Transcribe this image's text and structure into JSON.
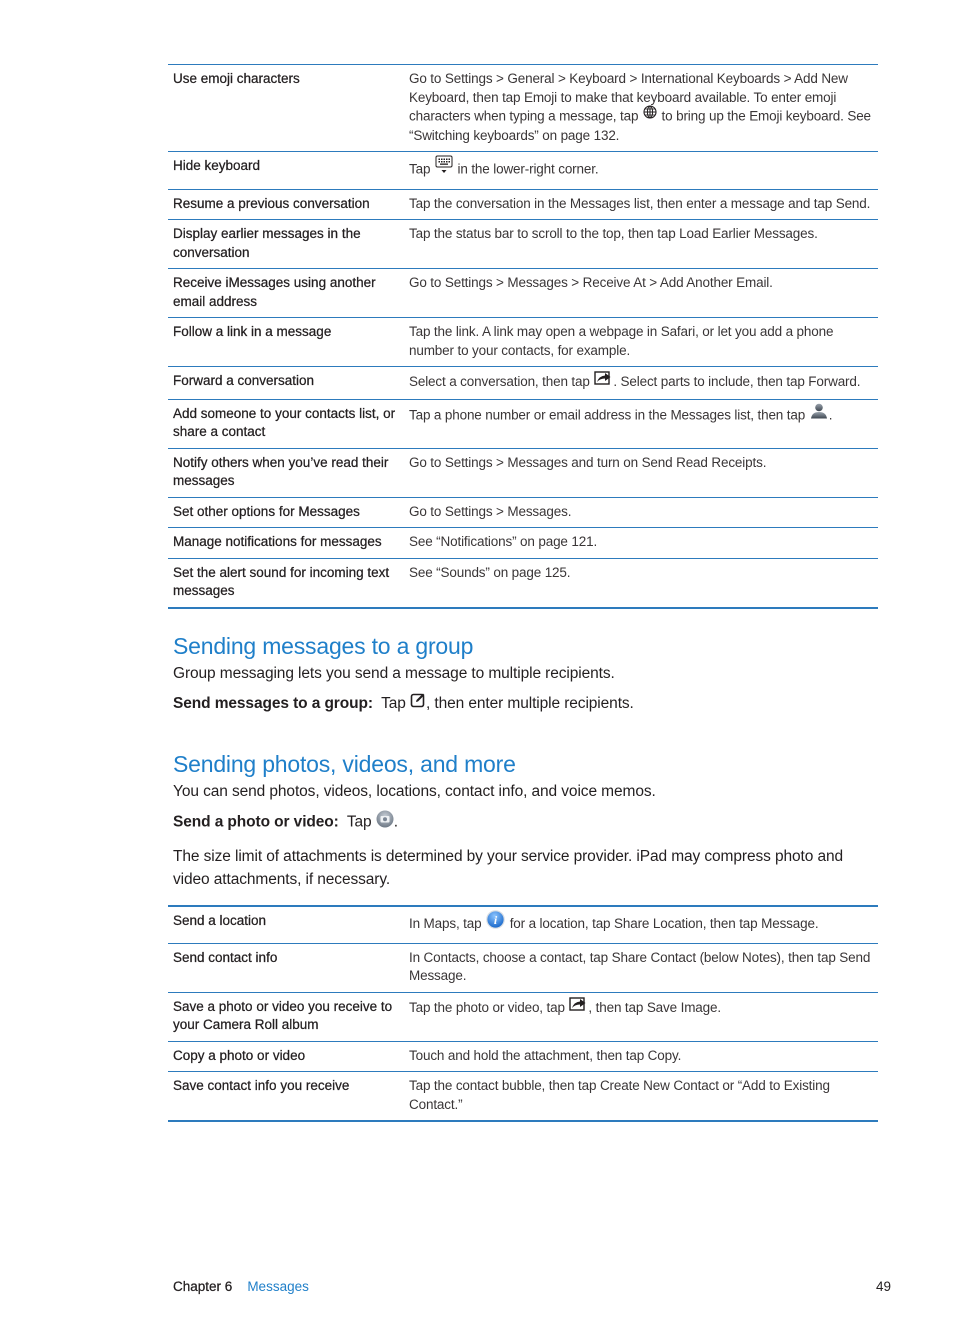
{
  "table1": {
    "rows": [
      {
        "task": "Use emoji characters",
        "how_parts": [
          "Go to Settings > General > Keyboard > International Keyboards > Add New Keyboard, then tap Emoji to make that keyboard available. To enter emoji characters when typing a message, tap ",
          " to bring up the Emoji keyboard. See “Switching keyboards” on page 132."
        ],
        "icon": "globe-icon"
      },
      {
        "task": "Hide keyboard",
        "how_parts": [
          "Tap ",
          " in the lower-right corner."
        ],
        "icon": "hide-keyboard-icon"
      },
      {
        "task": "Resume a previous conversation",
        "how_parts": [
          "Tap the conversation in the Messages list, then enter a message and tap Send."
        ]
      },
      {
        "task": "Display earlier messages in the conversation",
        "how_parts": [
          "Tap the status bar to scroll to the top, then tap Load Earlier Messages."
        ]
      },
      {
        "task": "Receive iMessages using another email address",
        "how_parts": [
          "Go to Settings > Messages > Receive At > Add Another Email."
        ]
      },
      {
        "task": "Follow a link in a message",
        "how_parts": [
          "Tap the link. A link may open a webpage in Safari, or let you add a phone number to your contacts, for example."
        ]
      },
      {
        "task": "Forward a conversation",
        "how_parts": [
          "Select a conversation, then tap ",
          ". Select parts to include, then tap Forward."
        ],
        "icon": "action-icon"
      },
      {
        "task": "Add someone to your contacts list, or share a contact",
        "how_parts": [
          "Tap a phone number or email address in the Messages list, then tap ",
          "."
        ],
        "icon": "contact-icon"
      },
      {
        "task": "Notify others when you’ve read their messages",
        "how_parts": [
          "Go to Settings > Messages and turn on Send Read Receipts."
        ]
      },
      {
        "task": "Set other options for Messages",
        "how_parts": [
          "Go to Settings > Messages."
        ]
      },
      {
        "task": "Manage notifications for messages",
        "how_parts": [
          "See “Notifications” on page 121."
        ]
      },
      {
        "task": "Set the alert sound for incoming text messages",
        "how_parts": [
          "See “Sounds” on page 125."
        ]
      }
    ]
  },
  "section_group": {
    "title": "Sending messages to a group",
    "intro": "Group messaging lets you send a message to multiple recipients.",
    "tip_label": "Send messages to a group:",
    "tip_before": "Tap ",
    "tip_after": ", then enter multiple recipients."
  },
  "section_photos": {
    "title": "Sending photos, videos, and more",
    "intro": "You can send photos, videos, locations, contact info, and voice memos.",
    "tip_label": "Send a photo or video:",
    "tip_before": "Tap ",
    "tip_after": ".",
    "note": "The size limit of attachments is determined by your service provider. iPad may compress photo and video attachments, if necessary."
  },
  "table2": {
    "rows": [
      {
        "task": "Send a location",
        "how_parts": [
          "In Maps, tap ",
          " for a location, tap Share Location, then tap Message."
        ],
        "icon": "info-icon"
      },
      {
        "task": "Send contact info",
        "how_parts": [
          "In Contacts, choose a contact, tap Share Contact (below Notes), then tap Send Message."
        ]
      },
      {
        "task": "Save a photo or video you receive to your Camera Roll album",
        "how_parts": [
          "Tap the photo or video, tap ",
          ", then tap Save Image."
        ],
        "icon": "action-icon"
      },
      {
        "task": "Copy a photo or video",
        "how_parts": [
          "Touch and hold the attachment, then tap Copy."
        ]
      },
      {
        "task": "Save contact info you receive",
        "how_parts": [
          "Tap the contact bubble, then tap Create New Contact or “Add to Existing Contact.”"
        ]
      }
    ]
  },
  "footer": {
    "chapter": "Chapter 6",
    "chapter_title": "Messages",
    "page_number": "49"
  },
  "colors": {
    "accent": "#1f7fc9",
    "rule": "#2d7bbd",
    "text": "#231f20"
  }
}
